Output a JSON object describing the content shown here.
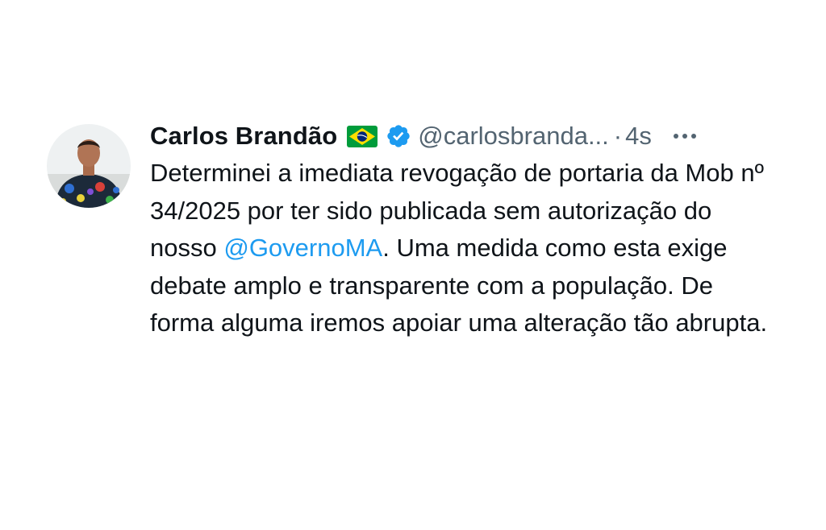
{
  "colors": {
    "text": "#0f1419",
    "secondary": "#536471",
    "link": "#1d9bf0",
    "verified": "#1d9bf0"
  },
  "tweet": {
    "author": {
      "display_name": "Carlos Brandão",
      "flag_icon": "brazil-flag-icon",
      "verified_icon": "verified-badge-icon",
      "handle": "@carlosbranda...",
      "separator": "·",
      "time": "4s"
    },
    "more_icon": "more-options-icon",
    "text": {
      "part1": "Determinei a imediata revogação de portaria da Mob nº 34/2025 por ter sido publicada sem autorização do nosso ",
      "mention": "@GovernoMA",
      "part2": ". Uma medida como esta exige debate amplo e transparente com a população. De forma alguma iremos apoiar uma alteração tão abrupta."
    }
  }
}
